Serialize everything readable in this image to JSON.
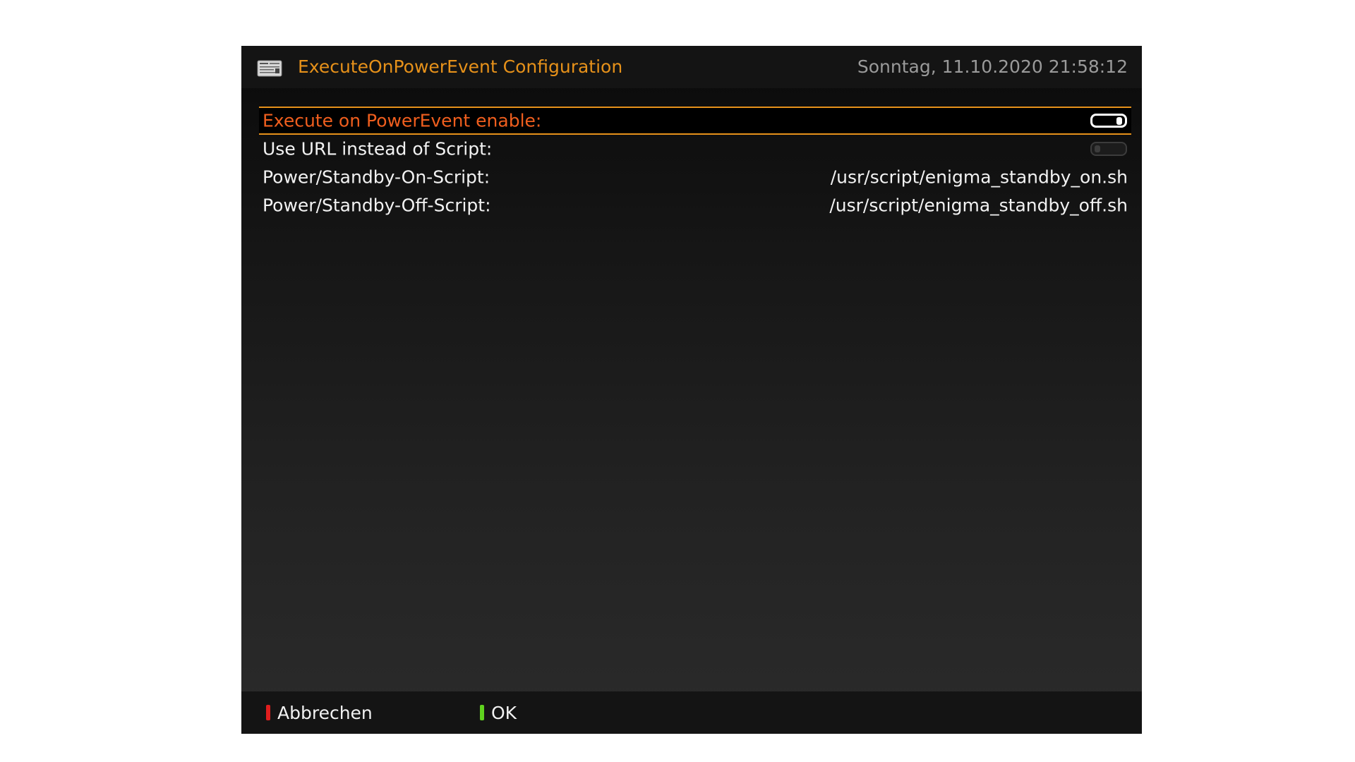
{
  "header": {
    "title": "ExecuteOnPowerEvent Configuration",
    "clock": "Sonntag, 11.10.2020  21:58:12",
    "icon": "setup-screen-icon"
  },
  "settings": [
    {
      "label": "Execute on PowerEvent enable:",
      "type": "toggle",
      "value": true,
      "selected": true
    },
    {
      "label": "Use URL instead of Script:",
      "type": "toggle",
      "value": false,
      "selected": false
    },
    {
      "label": "Power/Standby-On-Script:",
      "type": "text",
      "value": "/usr/script/enigma_standby_on.sh",
      "selected": false
    },
    {
      "label": "Power/Standby-Off-Script:",
      "type": "text",
      "value": "/usr/script/enigma_standby_off.sh",
      "selected": false
    }
  ],
  "footer": {
    "red_label": "Abbrechen",
    "green_label": "OK"
  },
  "colors": {
    "accent": "#e6911a",
    "selected_text": "#ef5e1e",
    "red_key": "#e01e1e",
    "green_key": "#5fd21e"
  }
}
